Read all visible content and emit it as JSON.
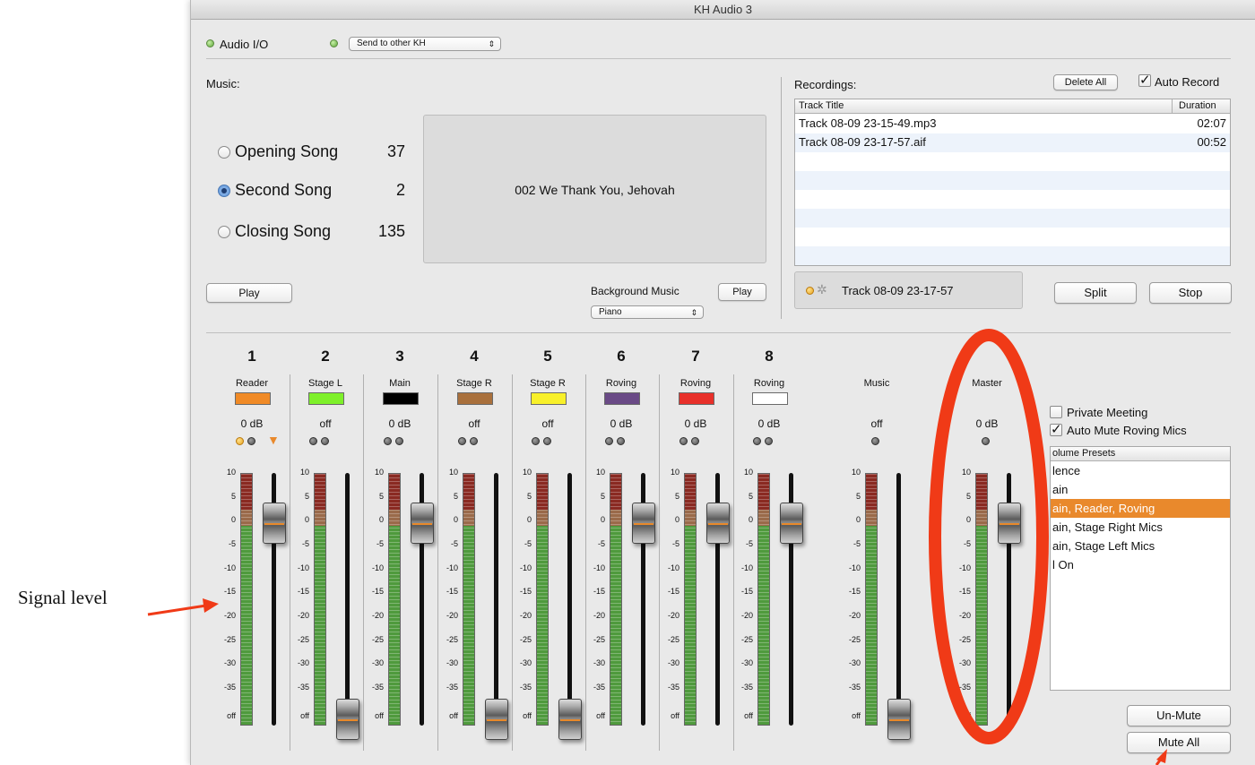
{
  "window": {
    "title": "KH Audio 3"
  },
  "toolbar": {
    "audio_io_label": "Audio I/O",
    "send_popup_value": "Send to other KH"
  },
  "music": {
    "label": "Music:",
    "songs": [
      {
        "label": "Opening Song",
        "number": "37",
        "selected": false
      },
      {
        "label": "Second Song",
        "number": "2",
        "selected": true
      },
      {
        "label": "Closing Song",
        "number": "135",
        "selected": false
      }
    ],
    "current_song": "002 We Thank You, Jehovah",
    "play_label": "Play",
    "background_music_label": "Background Music",
    "background_play_label": "Play",
    "background_popup_value": "Piano"
  },
  "recordings": {
    "label": "Recordings:",
    "delete_all_label": "Delete All",
    "auto_record_label": "Auto Record",
    "auto_record_checked": true,
    "columns": [
      "Track Title",
      "Duration"
    ],
    "rows": [
      {
        "title": "Track 08-09 23-15-49.mp3",
        "duration": "02:07"
      },
      {
        "title": "Track 08-09 23-17-57.aif",
        "duration": "00:52"
      }
    ],
    "current_track": "Track 08-09 23-17-57",
    "split_label": "Split",
    "stop_label": "Stop"
  },
  "scale_labels": [
    "10",
    "5",
    "0",
    "-5",
    "-10",
    "-15",
    "-20",
    "-25",
    "-30",
    "-35",
    "off"
  ],
  "channels": [
    {
      "number": "1",
      "name": "Reader",
      "color": "#f08a26",
      "level": "0 dB",
      "fader": "high"
    },
    {
      "number": "2",
      "name": "Stage L",
      "color": "#7ef02a",
      "level": "off",
      "fader": "low"
    },
    {
      "number": "3",
      "name": "Main",
      "color": "#000000",
      "level": "0 dB",
      "fader": "high"
    },
    {
      "number": "4",
      "name": "Stage R",
      "color": "#a9703c",
      "level": "off",
      "fader": "low"
    },
    {
      "number": "5",
      "name": "Stage R",
      "color": "#f8f02a",
      "level": "off",
      "fader": "low"
    },
    {
      "number": "6",
      "name": "Roving",
      "color": "#6a4a86",
      "level": "0 dB",
      "fader": "high"
    },
    {
      "number": "7",
      "name": "Roving",
      "color": "#e8302a",
      "level": "0 dB",
      "fader": "high"
    },
    {
      "number": "8",
      "name": "Roving",
      "color": "#ffffff",
      "level": "0 dB",
      "fader": "high"
    }
  ],
  "music_channel": {
    "name": "Music",
    "level": "off"
  },
  "master_channel": {
    "name": "Master",
    "level": "0 dB"
  },
  "options": {
    "private_meeting_label": "Private Meeting",
    "private_meeting_checked": false,
    "auto_mute_label": "Auto Mute Roving Mics",
    "auto_mute_checked": true
  },
  "presets": {
    "header": "olume Presets",
    "items": [
      "lence",
      "ain",
      "ain, Reader, Roving",
      "ain, Stage Right Mics",
      "ain, Stage Left Mics",
      "l On"
    ],
    "selected_index": 2
  },
  "mute": {
    "unmute_label": "Un-Mute",
    "mute_all_label": "Mute All"
  },
  "annotations": {
    "signal_level": "Signal level",
    "accent_color": "#f03a17"
  }
}
